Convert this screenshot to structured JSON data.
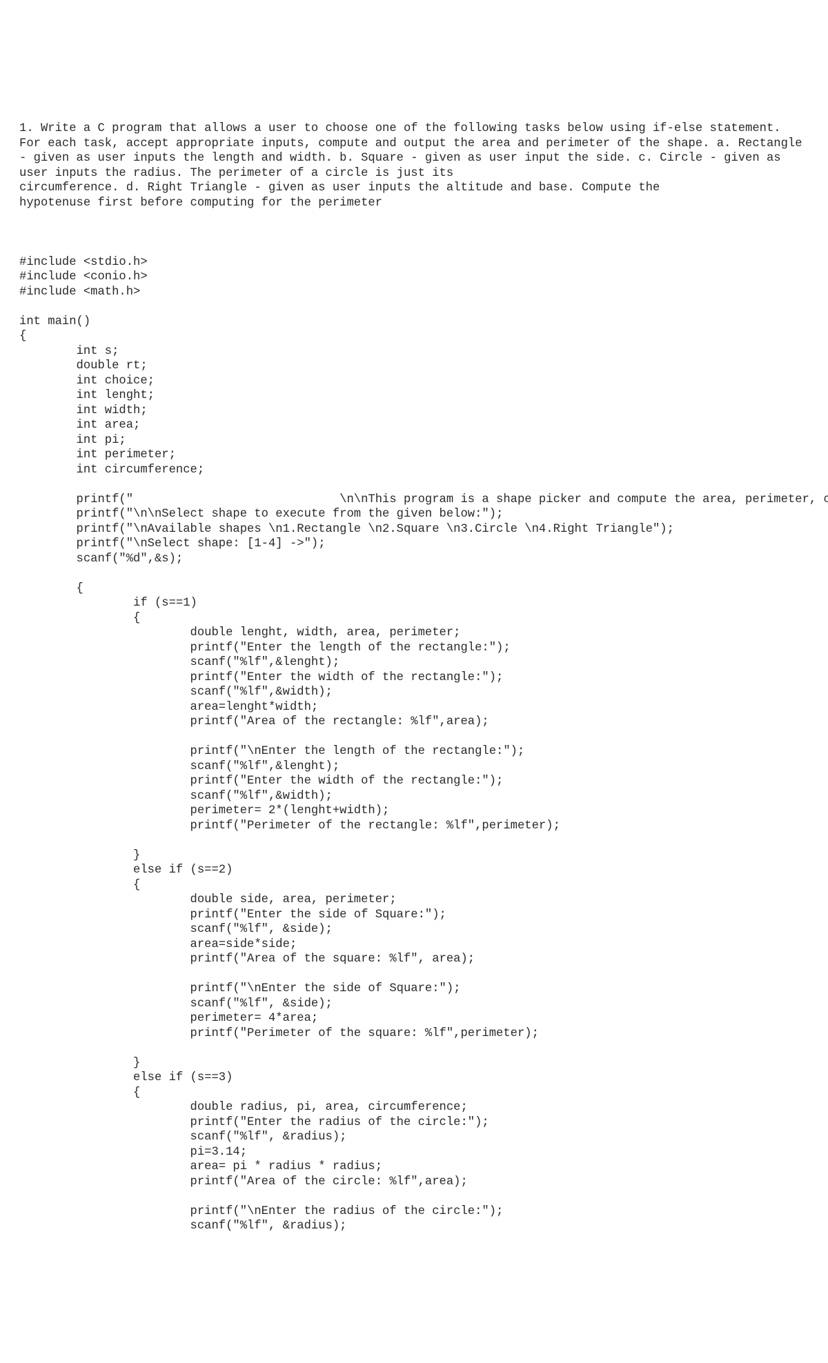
{
  "problem_text": "1. Write a C program that allows a user to choose one of the following tasks below using if-else statement. For each task, accept appropriate inputs, compute and output the area and perimeter of the shape. a. Rectangle - given as user inputs the length and width. b. Square - given as user input the side. c. Circle - given as user inputs the radius. The perimeter of a circle is just its\ncircumference. d. Right Triangle - given as user inputs the altitude and base. Compute the\nhypotenuse first before computing for the perimeter",
  "code_text": "#include <stdio.h>\n#include <conio.h>\n#include <math.h>\n\nint main()\n{\n        int s;\n        double rt;\n        int choice;\n        int lenght;\n        int width;\n        int area;\n        int pi;\n        int perimeter;\n        int circumference;\n\n        printf(\"                             \\n\\nThis program is a shape picker and compute the area, perimeter, circumference, and hypotenuse of the shape selected.\");\n        printf(\"\\n\\nSelect shape to execute from the given below:\");\n        printf(\"\\nAvailable shapes \\n1.Rectangle \\n2.Square \\n3.Circle \\n4.Right Triangle\");\n        printf(\"\\nSelect shape: [1-4] ->\");\n        scanf(\"%d\",&s);\n\n        {\n                if (s==1)\n                {\n                        double lenght, width, area, perimeter;\n                        printf(\"Enter the length of the rectangle:\");\n                        scanf(\"%lf\",&lenght);\n                        printf(\"Enter the width of the rectangle:\");\n                        scanf(\"%lf\",&width);\n                        area=lenght*width;\n                        printf(\"Area of the rectangle: %lf\",area);\n\n                        printf(\"\\nEnter the length of the rectangle:\");\n                        scanf(\"%lf\",&lenght);\n                        printf(\"Enter the width of the rectangle:\");\n                        scanf(\"%lf\",&width);\n                        perimeter= 2*(lenght+width);\n                        printf(\"Perimeter of the rectangle: %lf\",perimeter);\n\n                }\n                else if (s==2)\n                {\n                        double side, area, perimeter;\n                        printf(\"Enter the side of Square:\");\n                        scanf(\"%lf\", &side);\n                        area=side*side;\n                        printf(\"Area of the square: %lf\", area);\n\n                        printf(\"\\nEnter the side of Square:\");\n                        scanf(\"%lf\", &side);\n                        perimeter= 4*area;\n                        printf(\"Perimeter of the square: %lf\",perimeter);\n\n                }\n                else if (s==3)\n                {\n                        double radius, pi, area, circumference;\n                        printf(\"Enter the radius of the circle:\");\n                        scanf(\"%lf\", &radius);\n                        pi=3.14;\n                        area= pi * radius * radius;\n                        printf(\"Area of the circle: %lf\",area);\n\n                        printf(\"\\nEnter the radius of the circle:\");\n                        scanf(\"%lf\", &radius);"
}
